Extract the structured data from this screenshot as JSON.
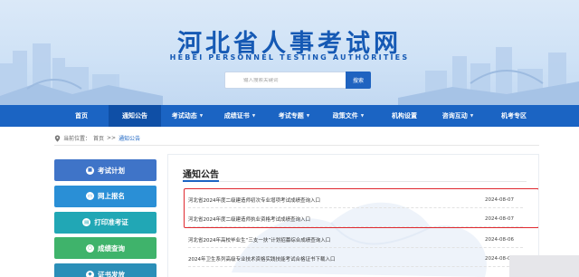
{
  "header": {
    "title": "河北省人事考试网",
    "subtitle": "HEBEI PERSONNEL TESTING AUTHORITIES",
    "search": {
      "placeholder": "输入搜索关键词",
      "button_label": "搜索"
    }
  },
  "nav": {
    "items": [
      {
        "label": "首页",
        "dropdown": false
      },
      {
        "label": "通知公告",
        "dropdown": false,
        "active": true
      },
      {
        "label": "考试动态",
        "dropdown": true
      },
      {
        "label": "成绩证书",
        "dropdown": true
      },
      {
        "label": "考试专题",
        "dropdown": true
      },
      {
        "label": "政策文件",
        "dropdown": true
      },
      {
        "label": "机构设置",
        "dropdown": false
      },
      {
        "label": "咨询互动",
        "dropdown": true
      },
      {
        "label": "机考专区",
        "dropdown": false
      }
    ],
    "caret": "▼"
  },
  "breadcrumb": {
    "prefix": "当前位置：",
    "home": "首页",
    "separator": ">>",
    "current": "通知公告"
  },
  "sidebar": {
    "items": [
      {
        "label": "考试计划",
        "icon": "calendar-icon",
        "glyph": "■"
      },
      {
        "label": "网上报名",
        "icon": "monitor-icon",
        "glyph": "▭"
      },
      {
        "label": "打印准考证",
        "icon": "printer-icon",
        "glyph": "▤"
      },
      {
        "label": "成绩查询",
        "icon": "search-icon",
        "glyph": "○"
      },
      {
        "label": "证书发放",
        "icon": "certificate-icon",
        "glyph": "◆"
      }
    ]
  },
  "main": {
    "title": "通知公告",
    "notices": [
      {
        "title": "河北省2024年度二级建造师初次专业增项考试成绩查询入口",
        "date": "2024-08-07"
      },
      {
        "title": "河北省2024年度二级建造师执业资格考试成绩查询入口",
        "date": "2024-08-07"
      },
      {
        "title": "河北省2024年高校毕业生“三支一扶”计划招募综合成绩查询入口",
        "date": "2024-08-06"
      },
      {
        "title": "2024年卫生系列高级专业技术资格实践技能考试合格证书下载入口",
        "date": "2024-08-05"
      }
    ]
  },
  "colors": {
    "primary": "#1b64c3",
    "nav_active": "#0f4fa6",
    "highlight": "#e0292f"
  }
}
